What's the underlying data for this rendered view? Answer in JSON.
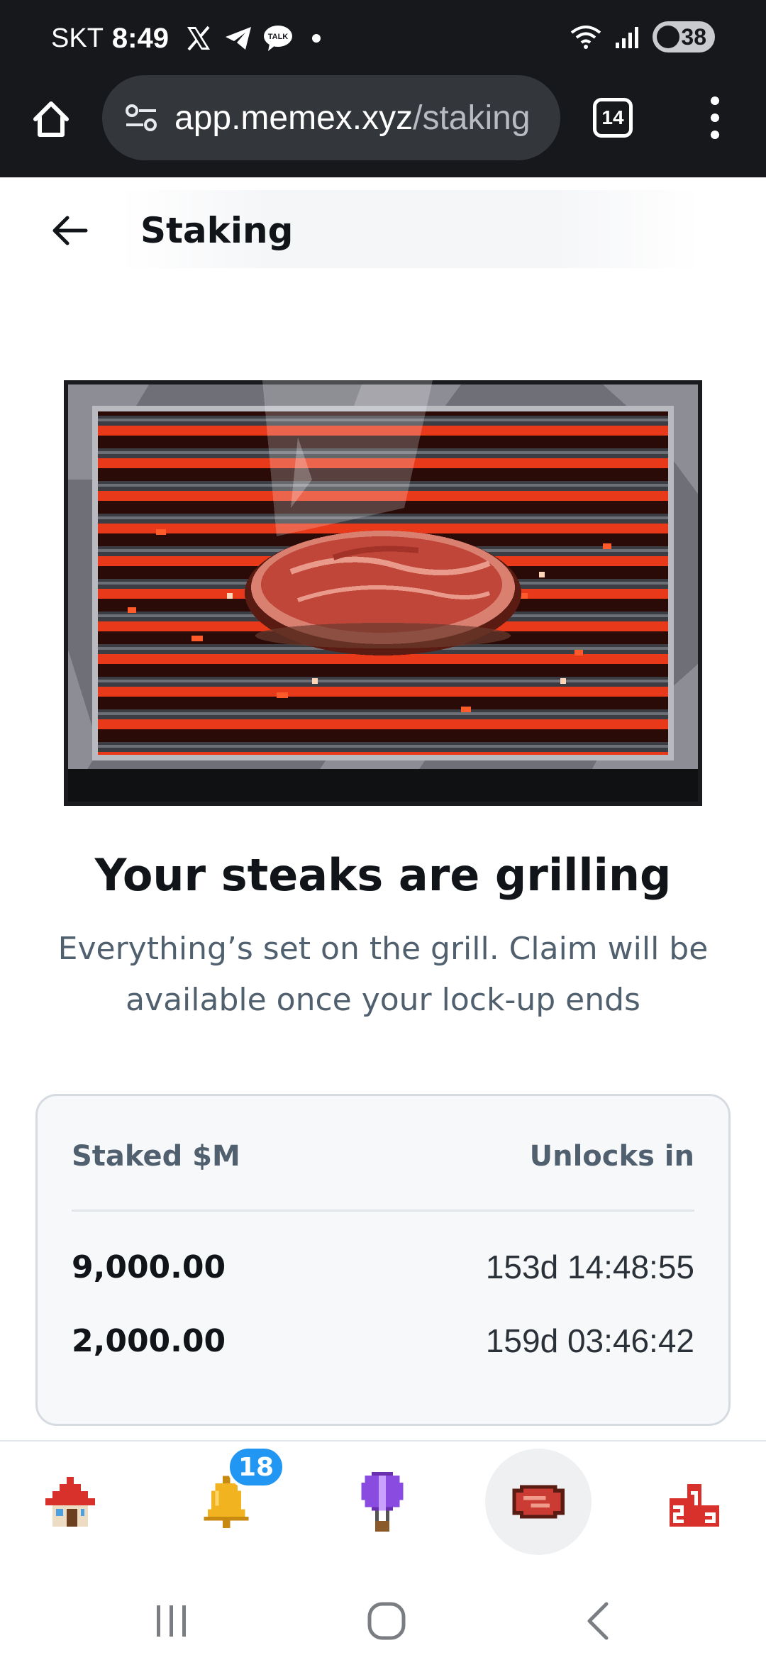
{
  "status_bar": {
    "carrier": "SKT",
    "time": "8:49",
    "battery": "38",
    "icons": [
      "x-icon",
      "telegram-icon",
      "kakaotalk-icon",
      "notification-dot",
      "wifi-icon",
      "signal-icon",
      "battery-icon"
    ]
  },
  "browser": {
    "url_host": "app.memex.xyz",
    "url_path": "/staking",
    "tab_count": "14"
  },
  "header": {
    "title": "Staking"
  },
  "hero": {
    "image": "pixel-art-steak-on-grill"
  },
  "main": {
    "headline": "Your steaks are grilling",
    "subtext": "Everything’s set on the grill. Claim will be available once your lock-up ends"
  },
  "stakes": {
    "col_amount": "Staked $M",
    "col_unlock": "Unlocks in",
    "rows": [
      {
        "amount": "9,000.00",
        "unlocks_in": "153d 14:48:55"
      },
      {
        "amount": "2,000.00",
        "unlocks_in": "159d 03:46:42"
      }
    ]
  },
  "bottom_nav": {
    "items": [
      "home",
      "notifications",
      "balloon",
      "staking",
      "leaderboard"
    ],
    "active": "staking",
    "notification_badge": "18"
  },
  "colors": {
    "chrome": "#16181c",
    "badge": "#2196f3",
    "muted_text": "#51606e",
    "card_bg": "#f7f8fa"
  }
}
